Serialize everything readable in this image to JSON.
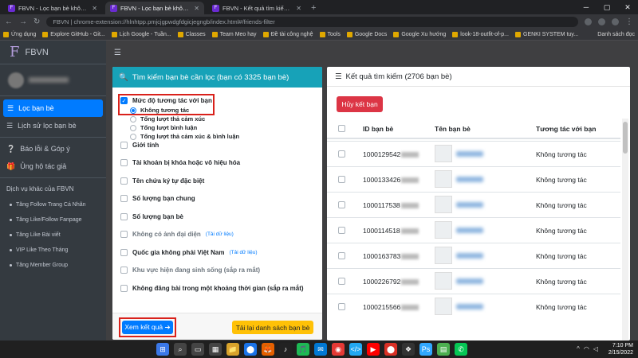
{
  "browser": {
    "tabs": [
      {
        "icon": "F",
        "title": "FBVN - Lọc bạn bè không tương tác",
        "active": false
      },
      {
        "icon": "F",
        "title": "FBVN - Lọc bạn bè không tương tác",
        "active": true
      },
      {
        "icon": "F",
        "title": "FBVN - Kết quả tìm kiếm - filte",
        "active": false
      }
    ],
    "url_prefix": "FBVN | chrome-extension://",
    "url_rest": "hlnhtpp.pmjcjgpwdgfdgicjegngb/index.html#/friends-filter",
    "bookmarks": [
      "Ứng dụng",
      "Explore GitHub - Git...",
      "Lịch Google - Tuần...",
      "Classes",
      "Team Meo hay",
      "Đề tài công nghệ",
      "Tools",
      "Google Docs",
      "Google Xu hướng",
      "look-18-outfit-of-p...",
      "GENKI SYSTEM tuy..."
    ],
    "reading_list": "Danh sách đọc"
  },
  "sidebar": {
    "logo": "F",
    "brand": "FBVN",
    "items": [
      {
        "icon": "☰",
        "label": "Lọc bạn bè",
        "active": true
      },
      {
        "icon": "☰",
        "label": "Lịch sử lọc bạn bè",
        "active": false
      }
    ],
    "items2": [
      {
        "icon": "❔",
        "label": "Báo lỗi & Góp ý"
      },
      {
        "icon": "🎁",
        "label": "Ủng hộ tác giả"
      }
    ],
    "services_title": "Dịch vụ khác của FBVN",
    "services": [
      "Tăng Follow Trang Cá Nhân",
      "Tăng Like/Follow Fanpage",
      "Tăng Like Bài viết",
      "VIP Like Theo Tháng",
      "Tăng Member Group"
    ]
  },
  "filter": {
    "title": "Tìm kiếm bạn bè cần lọc (bạn có 3325 bạn bè)",
    "interaction_label": "Mức độ tương tác với bạn",
    "interaction_options": [
      "Không tương tác",
      "Tổng lượt thả cảm xúc",
      "Tổng lượt bình luận",
      "Tổng lượt thả cảm xúc & bình luận"
    ],
    "options": [
      {
        "label": "Giới tính",
        "note": "",
        "dim": false
      },
      {
        "label": "Tài khoản bị khóa hoặc vô hiệu hóa",
        "note": "",
        "dim": false
      },
      {
        "label": "Tên chứa ký tự đặc biệt",
        "note": "",
        "dim": false
      },
      {
        "label": "Số lượng bạn chung",
        "note": "",
        "dim": false
      },
      {
        "label": "Số lượng bạn bè",
        "note": "",
        "dim": false
      },
      {
        "label": "Không có ảnh đại diện",
        "note": "(Tải dữ liệu)",
        "dim": true
      },
      {
        "label": "Quốc gia không phải Việt Nam",
        "note": "(Tải dữ liệu)",
        "dim": false
      },
      {
        "label": "Khu vực hiện đang sinh sống (sắp ra mắt)",
        "note": "",
        "dim": true
      },
      {
        "label": "Không đăng bài trong một khoảng thời gian (sắp ra mắt)",
        "note": "",
        "dim": false
      }
    ],
    "view_button": "Xem kết quả ➔",
    "reload_button": "Tải lại danh sách bạn bè"
  },
  "results": {
    "title": "Kết quả tìm kiếm (2706 bạn bè)",
    "cancel_button": "Hủy kết bạn",
    "columns": [
      "ID bạn bè",
      "Tên bạn bè",
      "Tương tác với bạn"
    ],
    "rows": [
      {
        "id": "1000129542",
        "interaction": "Không tương tác"
      },
      {
        "id": "1000133426",
        "interaction": "Không tương tác"
      },
      {
        "id": "1000117538",
        "interaction": "Không tương tác"
      },
      {
        "id": "1000114518",
        "interaction": "Không tương tác"
      },
      {
        "id": "1000163783",
        "interaction": "Không tương tác"
      },
      {
        "id": "1000226792",
        "interaction": "Không tương tác"
      },
      {
        "id": "1000215566",
        "interaction": "Không tương tác"
      }
    ]
  },
  "taskbar": {
    "time": "7:10 PM",
    "date": "2/15/2022",
    "apps": [
      "⊞",
      "⌕",
      "▭",
      "▦",
      "📁",
      "⬤",
      "🦊",
      "♪",
      "🎵",
      "✉",
      "◉",
      "</>",
      "▶",
      "⬤",
      "❖",
      "Ps",
      "▤",
      "✆"
    ]
  },
  "colors": {
    "accent": "#007bff",
    "header_teal": "#17a2b8",
    "danger": "#dc3545",
    "warning": "#ffc107",
    "highlight_red": "#d9211b"
  }
}
